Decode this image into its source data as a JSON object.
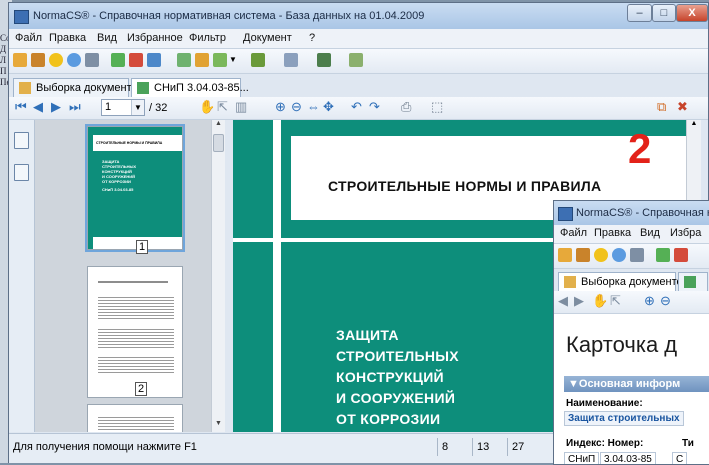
{
  "background": {
    "fragments": [
      "Co",
      "Д",
      "Л",
      "П",
      "Пe"
    ]
  },
  "window": {
    "title": "NormaCS® - Справочная нормативная система - База данных на 01.04.2009",
    "controls": {
      "minimize": "–",
      "maximize": "□",
      "close": "X"
    }
  },
  "menu": {
    "items": [
      "Файл",
      "Правка",
      "Вид",
      "Избранное",
      "Фильтр",
      "Документ",
      "?"
    ]
  },
  "tabs": [
    {
      "label": "Выборка документов",
      "icon": "folder-icon"
    },
    {
      "label": "СНиП 3.04.03-85...",
      "icon": "document-icon"
    }
  ],
  "navigation": {
    "current_page": "1",
    "total_pages": "/ 32"
  },
  "thumbnails": {
    "page1": {
      "heading": "СТРОИТЕЛЬНЫЕ НОРМЫ И ПРАВИЛА",
      "title_lines": [
        "ЗАЩИТА",
        "СТРОИТЕЛЬНЫХ",
        "КОНСТРУКЦИЙ",
        "И СООРУЖЕНИЙ",
        "ОТ КОРРОЗИИ"
      ],
      "code": "СНиП 3.04.03-85",
      "number": "1"
    },
    "page2": {
      "number": "2"
    }
  },
  "document": {
    "heading": "СТРОИТЕЛЬНЫЕ НОРМЫ И ПРАВИЛА",
    "title_lines": [
      "ЗАЩИТА",
      "СТРОИТЕЛЬНЫХ",
      "КОНСТРУКЦИЙ",
      "И СООРУЖЕНИЙ",
      "ОТ КОРРОЗИИ"
    ]
  },
  "marker": "2",
  "status": {
    "help_text": "Для получения помощи нажмите F1",
    "cells": [
      "8",
      "13",
      "27"
    ]
  },
  "window2": {
    "title": "NormaCS® - Справочная н",
    "menu": [
      "Файл",
      "Правка",
      "Вид",
      "Избра"
    ],
    "tab_label": "Выборка документов",
    "card_title": "Карточка д",
    "section_label": "▼Основная информ",
    "name_label": "Наименование:",
    "name_value": "Защита строительных",
    "index_label": "Индекс: Номер:",
    "type_label": "Ти",
    "index_value": "СНиП",
    "number_value": "3.04.03-85",
    "type_value": "С"
  },
  "colors": {
    "teal": "#0d8e7b",
    "marker": "#e32219"
  }
}
